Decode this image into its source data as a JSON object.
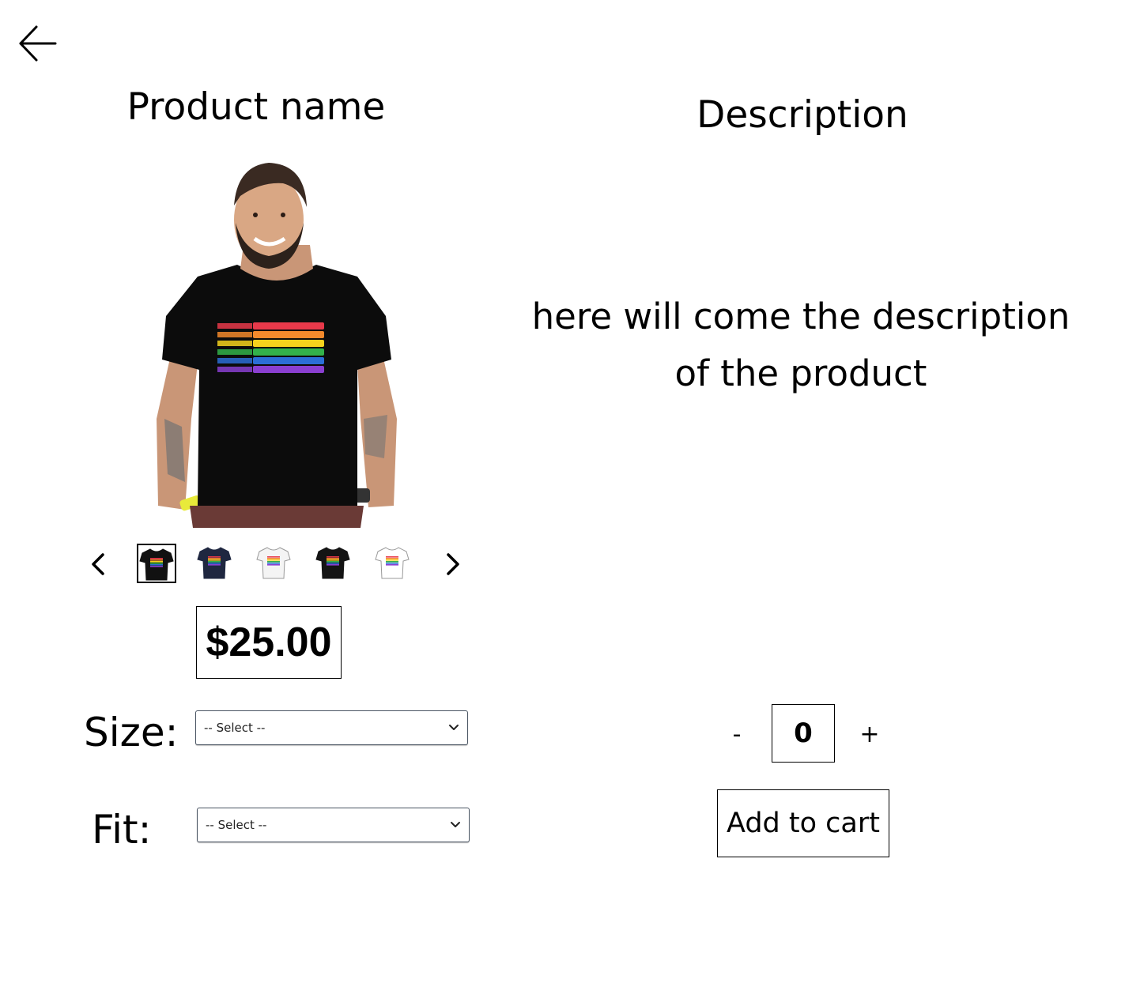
{
  "header": {
    "back_icon": "arrow-left-icon"
  },
  "product": {
    "name": "Product name",
    "price": "$25.00",
    "photo_icon": "tshirt-model-photo"
  },
  "description": {
    "title": "Description",
    "body": "here will come the description of the product"
  },
  "carousel": {
    "prev_icon": "chevron-left-icon",
    "next_icon": "chevron-right-icon",
    "thumbnails": [
      {
        "name": "black-rainbow-stripes",
        "color": "#111111",
        "selected": true
      },
      {
        "name": "navy-rainbow-fist",
        "color": "#1f2740",
        "selected": false
      },
      {
        "name": "white-pride-rainbow",
        "color": "#f4f4f4",
        "selected": false
      },
      {
        "name": "black-figure-print",
        "color": "#141414",
        "selected": false
      },
      {
        "name": "white-ringer-stripe",
        "color": "#ffffff",
        "selected": false
      }
    ]
  },
  "options": {
    "size": {
      "label": "Size:",
      "value": "-- Select --"
    },
    "fit": {
      "label": "Fit:",
      "value": "-- Select --"
    }
  },
  "quantity": {
    "minus": "-",
    "value": "0",
    "plus": "+"
  },
  "actions": {
    "add_to_cart": "Add to cart"
  },
  "colors": {
    "stripes": [
      "#e8394a",
      "#f58a2c",
      "#f6d21d",
      "#33b24a",
      "#2b6fd6",
      "#8a3fd1"
    ]
  }
}
